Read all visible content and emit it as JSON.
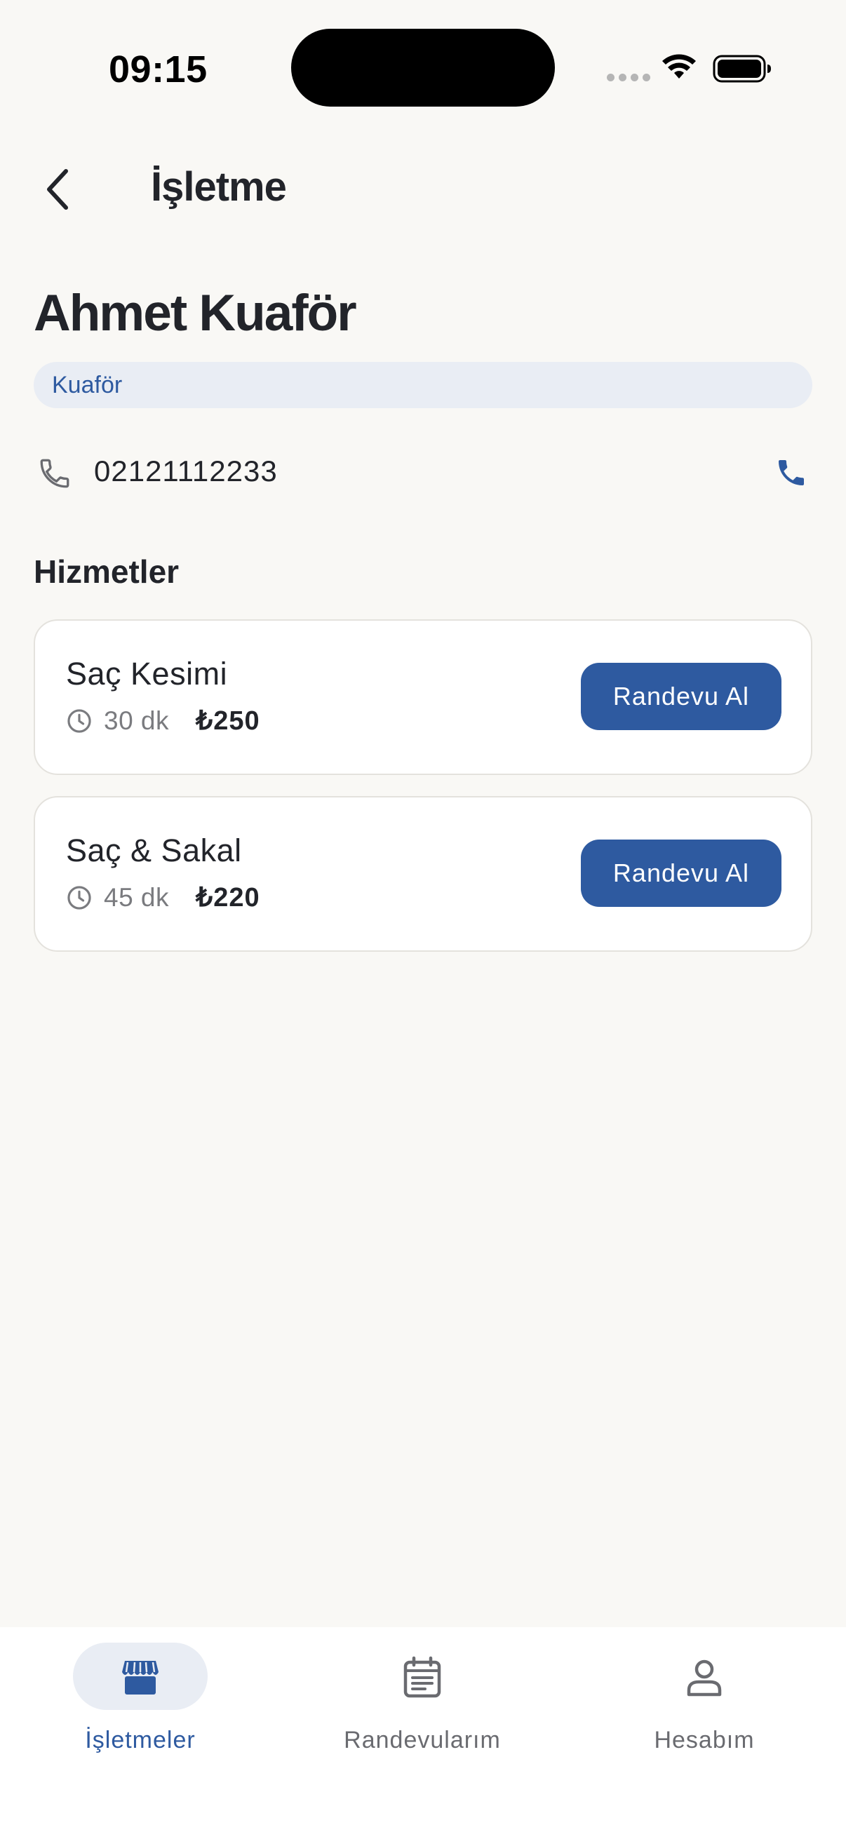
{
  "status_bar": {
    "time": "09:15"
  },
  "header": {
    "title": "İşletme",
    "back_icon": "chevron-left-icon"
  },
  "business": {
    "name": "Ahmet Kuaför",
    "category": "Kuaför",
    "phone": "02121112233"
  },
  "services_section": {
    "title": "Hizmetler",
    "items": [
      {
        "name": "Saç Kesimi",
        "duration": "30 dk",
        "price": "₺250",
        "button": "Randevu Al"
      },
      {
        "name": "Saç & Sakal",
        "duration": "45 dk",
        "price": "₺220",
        "button": "Randevu Al"
      }
    ]
  },
  "bottom_nav": {
    "items": [
      {
        "label": "İşletmeler",
        "icon": "storefront-icon",
        "active": true
      },
      {
        "label": "Randevularım",
        "icon": "calendar-list-icon",
        "active": false
      },
      {
        "label": "Hesabım",
        "icon": "person-icon",
        "active": false
      }
    ]
  },
  "colors": {
    "accent": "#2e5aa0",
    "background": "#f9f8f5",
    "chip_background": "#e9edf4"
  }
}
